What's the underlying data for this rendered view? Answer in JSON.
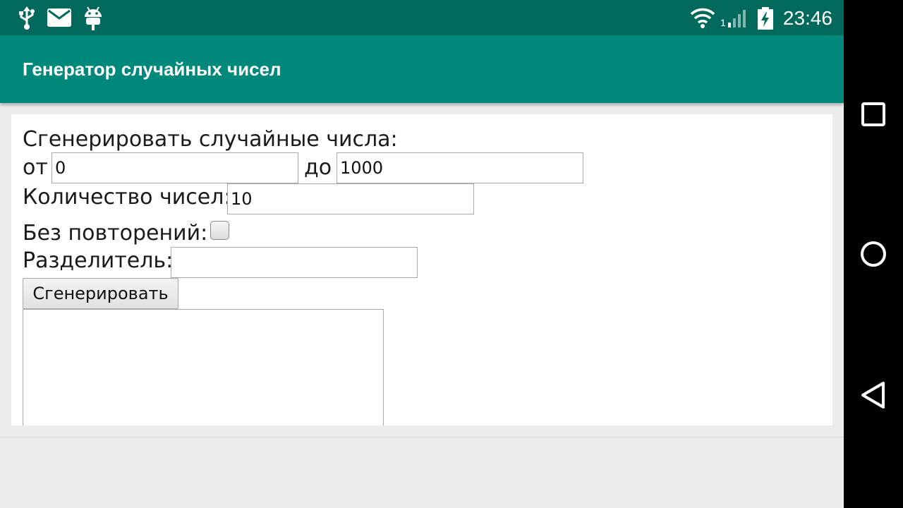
{
  "status_bar": {
    "time": "23:46",
    "signal_sim_label": "1",
    "left_icons": [
      "usb-icon",
      "mail-icon",
      "android-debug-icon"
    ],
    "right_icons": [
      "wifi-icon",
      "cell-signal-icon",
      "battery-charging-icon"
    ]
  },
  "app_bar": {
    "title": "Генератор случайных чисел",
    "color": "#00897b"
  },
  "form": {
    "heading": "Сгенерировать случайные числа:",
    "from_label": "от",
    "from_value": "0",
    "to_label": "до",
    "to_value": "1000",
    "count_label": "Количество чисел:",
    "count_value": "10",
    "no_repeat_label": "Без повторений:",
    "no_repeat_checked": false,
    "separator_label": "Разделитель:",
    "separator_value": "",
    "generate_label": "Сгенерировать",
    "result_value": ""
  },
  "nav_bar": {
    "icons": [
      "recent-apps-icon",
      "home-icon",
      "back-icon"
    ]
  }
}
